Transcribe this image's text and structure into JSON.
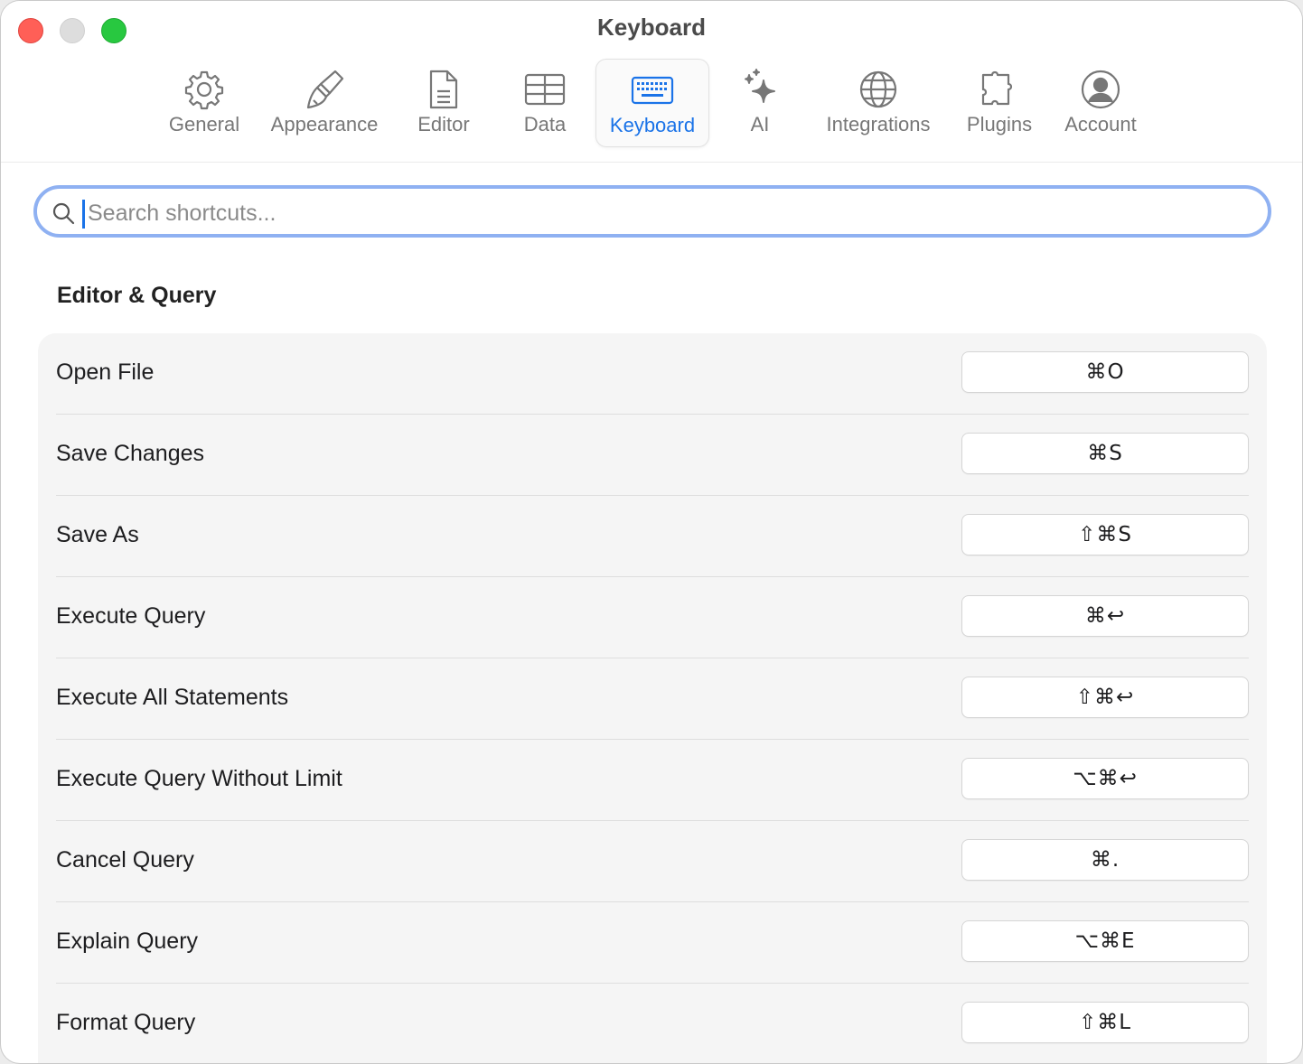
{
  "window": {
    "title": "Keyboard"
  },
  "tabs": [
    {
      "label": "General",
      "icon": "gear-icon"
    },
    {
      "label": "Appearance",
      "icon": "paintbrush-icon"
    },
    {
      "label": "Editor",
      "icon": "document-icon"
    },
    {
      "label": "Data",
      "icon": "table-icon"
    },
    {
      "label": "Keyboard",
      "icon": "keyboard-icon",
      "active": true
    },
    {
      "label": "AI",
      "icon": "sparkles-icon"
    },
    {
      "label": "Integrations",
      "icon": "globe-icon"
    },
    {
      "label": "Plugins",
      "icon": "puzzle-icon"
    },
    {
      "label": "Account",
      "icon": "person-circle-icon"
    }
  ],
  "search": {
    "placeholder": "Search shortcuts...",
    "value": ""
  },
  "section": {
    "title": "Editor & Query"
  },
  "shortcuts": [
    {
      "label": "Open File",
      "keys": "⌘O"
    },
    {
      "label": "Save Changes",
      "keys": "⌘S"
    },
    {
      "label": "Save As",
      "keys": "⇧⌘S"
    },
    {
      "label": "Execute Query",
      "keys": "⌘↩"
    },
    {
      "label": "Execute All Statements",
      "keys": "⇧⌘↩"
    },
    {
      "label": "Execute Query Without Limit",
      "keys": "⌥⌘↩"
    },
    {
      "label": "Cancel Query",
      "keys": "⌘."
    },
    {
      "label": "Explain Query",
      "keys": "⌥⌘E"
    },
    {
      "label": "Format Query",
      "keys": "⇧⌘L"
    }
  ],
  "colors": {
    "accent": "#1a73e8",
    "search_ring": "#8fb1f2",
    "close": "#ff5f57",
    "minimize": "#dddddd",
    "maximize": "#28c840"
  }
}
